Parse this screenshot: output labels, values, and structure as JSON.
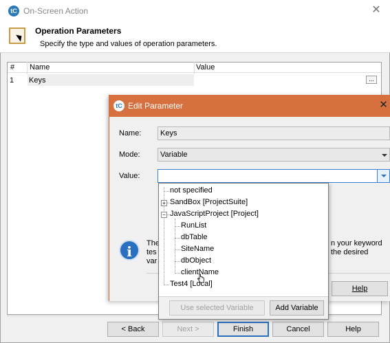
{
  "outer": {
    "title": "On-Screen Action",
    "header_title": "Operation Parameters",
    "header_subtitle": "Specify the type and values of operation parameters.",
    "table": {
      "columns": [
        "#",
        "Name",
        "Value"
      ],
      "rows": [
        {
          "num": "1",
          "name": "Keys",
          "value": ""
        }
      ],
      "ellipsis_label": "..."
    },
    "buttons": {
      "back": "< Back",
      "next": "Next >",
      "finish": "Finish",
      "cancel": "Cancel",
      "help": "Help"
    }
  },
  "dialog": {
    "title": "Edit Parameter",
    "name_label": "Name:",
    "name_value": "Keys",
    "mode_label": "Mode:",
    "mode_value": "Variable",
    "value_label": "Value:",
    "value_value": "",
    "info_left_lines": [
      "The",
      "tes",
      "var"
    ],
    "info_right_lines": [
      "n your keyword",
      "the desired"
    ],
    "help_button": "Help"
  },
  "tree": {
    "items": [
      {
        "label": "not specified",
        "level": 0
      },
      {
        "label": "SandBox [ProjectSuite]",
        "level": 0,
        "expander": "+"
      },
      {
        "label": "JavaScriptProject [Project]",
        "level": 0,
        "expander": "−"
      },
      {
        "label": "RunList",
        "level": 1
      },
      {
        "label": "dbTable",
        "level": 1
      },
      {
        "label": "SiteName",
        "level": 1
      },
      {
        "label": "dbObject",
        "level": 1
      },
      {
        "label": "clientName",
        "level": 1
      },
      {
        "label": "Test4 [Local]",
        "level": 0
      }
    ],
    "use_selected_button": "Use selected Variable",
    "add_variable_button": "Add Variable"
  },
  "icons": {
    "app_logo": "testcomplete-logo-icon",
    "header_icon": "operation-parameters-icon",
    "info": "info-icon",
    "close": "close-icon",
    "dropdown": "chevron-down-icon"
  },
  "colors": {
    "dialog_titlebar": "#d6713f",
    "accent": "#2a6fbf"
  }
}
